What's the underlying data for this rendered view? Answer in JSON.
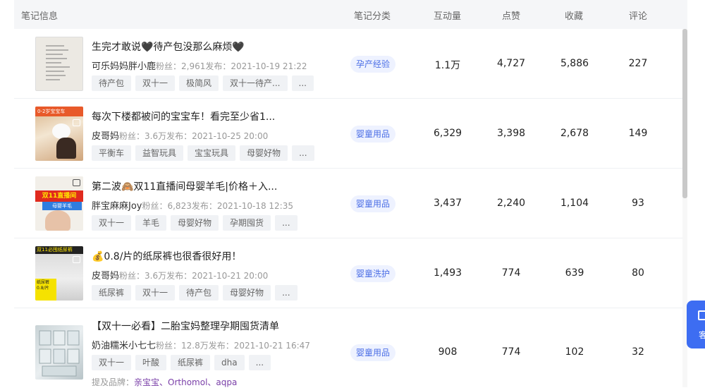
{
  "header": {
    "col_info": "笔记信息",
    "col_category": "笔记分类",
    "col_interactions": "互动量",
    "col_likes": "点赞",
    "col_favorites": "收藏",
    "col_comments": "评论"
  },
  "rows": [
    {
      "title": "生完才敢说🖤待产包没那么麻烦🖤",
      "author": "可乐妈妈胖小鹿",
      "followers_label": "粉丝：2,961",
      "published": "发布：2021-10-19 21:22",
      "tags": [
        "待产包",
        "双十一",
        "极简风",
        "双十一待产...",
        "..."
      ],
      "category": "孕产经验",
      "interactions": "1.1万",
      "likes": "4,727",
      "favorites": "5,886",
      "comments": "227"
    },
    {
      "title": "每次下楼都被问的宝宝车！看完至少省1...",
      "author": "皮哥妈",
      "followers_label": "粉丝：3.6万",
      "published": "发布：2021-10-25 20:00",
      "tags": [
        "平衡车",
        "益智玩具",
        "宝宝玩具",
        "母婴好物",
        "..."
      ],
      "category": "婴童用品",
      "interactions": "6,329",
      "likes": "3,398",
      "favorites": "2,678",
      "comments": "149"
    },
    {
      "title": "第二波🙈双11直播间母婴羊毛|价格＋入...",
      "author": "胖宝麻麻Joy",
      "followers_label": "粉丝：6,823",
      "published": "发布：2021-10-18 12:35",
      "tags": [
        "双十一",
        "羊毛",
        "母婴好物",
        "孕期囤货",
        "..."
      ],
      "category": "婴童用品",
      "interactions": "3,437",
      "likes": "2,240",
      "favorites": "1,104",
      "comments": "93"
    },
    {
      "title": "💰0.8/片的纸尿裤也很香很好用！",
      "author": "皮哥妈",
      "followers_label": "粉丝：3.6万",
      "published": "发布：2021-10-21 20:00",
      "tags": [
        "纸尿裤",
        "双十一",
        "待产包",
        "母婴好物",
        "..."
      ],
      "category": "婴童洗护",
      "interactions": "1,493",
      "likes": "774",
      "favorites": "639",
      "comments": "80"
    },
    {
      "title": "【双十一必看】二胎宝妈整理孕期囤货清单",
      "author": "奶油糯米小七七",
      "followers_label": "粉丝：12.8万",
      "published": "发布：2021-10-21 16:47",
      "tags": [
        "双十一",
        "叶酸",
        "纸尿裤",
        "dha",
        "..."
      ],
      "category": "婴童用品",
      "interactions": "908",
      "likes": "774",
      "favorites": "102",
      "comments": "32",
      "brand_label": "提及品牌：",
      "brands": "亲宝宝、Orthomol、aqpa"
    }
  ],
  "thumbnails": {
    "row2_text": "0-2岁宝宝车",
    "row3_text": "双11直播间",
    "row3_sub": "母婴羊毛",
    "row4_text": "双11必囤纸尿裤",
    "row4_sub": "纸尿裤 0.8/片"
  },
  "float_button": {
    "label": "客"
  },
  "colors": {
    "header_bg": "#f5f6f8",
    "category_badge_bg": "#eef2ff",
    "category_badge_text": "#4b6ee6",
    "brand_text": "#7a3fa8",
    "float_button_bg": "#3d6df2"
  }
}
